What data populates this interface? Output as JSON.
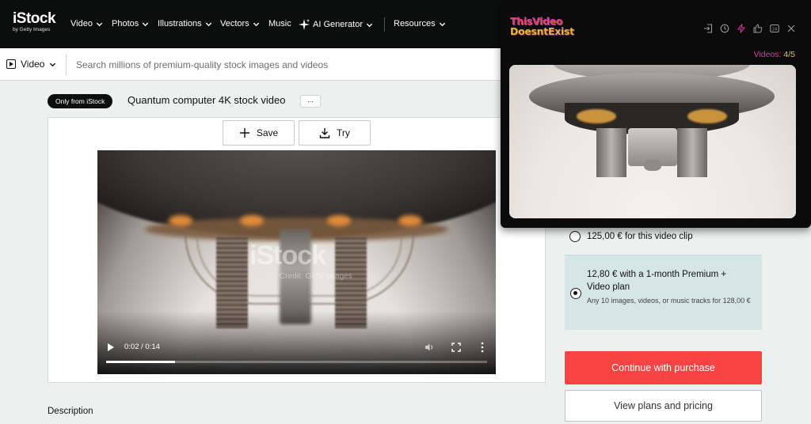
{
  "nav": {
    "logo_main": "iStock",
    "logo_sub": "by Getty Images",
    "video": "Video",
    "photos": "Photos",
    "illustrations": "Illustrations",
    "vectors": "Vectors",
    "music": "Music",
    "ai_generator": "AI Generator",
    "resources": "Resources"
  },
  "search": {
    "media_type": "Video",
    "placeholder": "Search millions of premium-quality stock images and videos"
  },
  "asset": {
    "badge": "Only from iStock",
    "title": "Quantum computer 4K stock video",
    "more": "...",
    "save_label": "Save",
    "try_label": "Try"
  },
  "player": {
    "watermark": "iStock",
    "watermark_sub": "Credit: Getty Images",
    "time": "0:02 / 0:14",
    "progress": 0.18
  },
  "description_heading": "Description",
  "purchase": {
    "option1": "125,00 € for this video clip",
    "option2": "12,80 € with a 1-month Premium + Video plan",
    "option2_sub": "Any 10 images, videos, or music tracks for 128,00 €",
    "selected": 2,
    "continue": "Continue with purchase",
    "view_plans": "View plans and pricing"
  },
  "extension": {
    "logo_line1": "ThisVideo",
    "logo_line2": "DoesntExist",
    "count_label": "Videos:",
    "count_value": "4/5"
  },
  "colors": {
    "nav_bg": "#0c0d0d",
    "cta_red": "#fa4444",
    "premium_bg": "#d6e6e4",
    "ext_pink": "#e2389a",
    "ext_gold": "#e5c341"
  }
}
